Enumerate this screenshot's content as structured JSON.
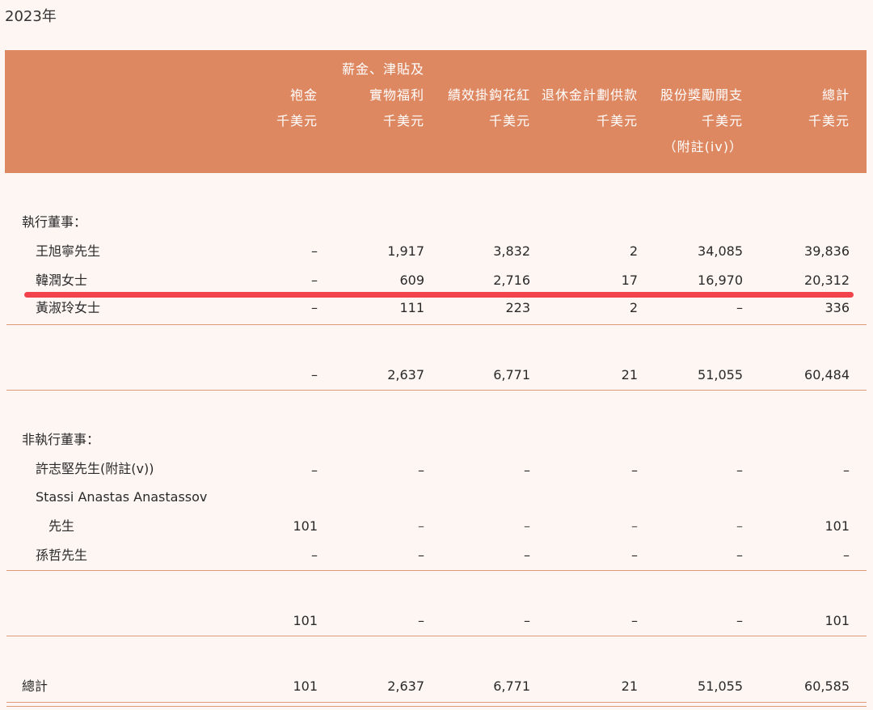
{
  "year_label": "2023年",
  "headers": [
    {
      "lines": [
        "",
        "袍金",
        "千美元",
        ""
      ]
    },
    {
      "lines": [
        "薪金、津貼及",
        "實物福利",
        "千美元",
        ""
      ]
    },
    {
      "lines": [
        "",
        "績效掛鈎花紅",
        "千美元",
        ""
      ]
    },
    {
      "lines": [
        "",
        "退休金計劃供款",
        "千美元",
        ""
      ]
    },
    {
      "lines": [
        "",
        "股份獎勵開支",
        "千美元",
        "（附註(iv)）"
      ]
    },
    {
      "lines": [
        "",
        "總計",
        "千美元",
        ""
      ]
    }
  ],
  "sections": {
    "executive_heading": "執行董事：",
    "executive_rows": [
      {
        "name": "王旭寧先生",
        "values": [
          "–",
          "1,917",
          "3,832",
          "2",
          "34,085",
          "39,836"
        ]
      },
      {
        "name": "韓潤女士",
        "values": [
          "–",
          "609",
          "2,716",
          "17",
          "16,970",
          "20,312"
        ]
      },
      {
        "name": "黃淑玲女士",
        "values": [
          "–",
          "111",
          "223",
          "2",
          "–",
          "336"
        ]
      }
    ],
    "executive_subtotal": [
      "–",
      "2,637",
      "6,771",
      "21",
      "51,055",
      "60,484"
    ],
    "nonexec_heading": "非執行董事：",
    "nonexec_rows": [
      {
        "name": "許志堅先生(附註(v))",
        "values": [
          "–",
          "–",
          "–",
          "–",
          "–",
          "–"
        ]
      },
      {
        "name": "Stassi Anastas Anastassov",
        "values": [
          "",
          "",
          "",
          "",
          "",
          ""
        ]
      },
      {
        "name": "先生",
        "values": [
          "101",
          "–",
          "–",
          "–",
          "–",
          "101"
        ]
      },
      {
        "name": "孫哲先生",
        "values": [
          "–",
          "–",
          "–",
          "–",
          "–",
          "–"
        ]
      }
    ],
    "nonexec_subtotal": [
      "101",
      "–",
      "–",
      "–",
      "–",
      "101"
    ],
    "total_label": "總計",
    "total_values": [
      "101",
      "2,637",
      "6,771",
      "21",
      "51,055",
      "60,585"
    ]
  },
  "colors": {
    "header_bg": "#de8862",
    "rule": "#e09a78",
    "annotation": "#f2434d"
  }
}
